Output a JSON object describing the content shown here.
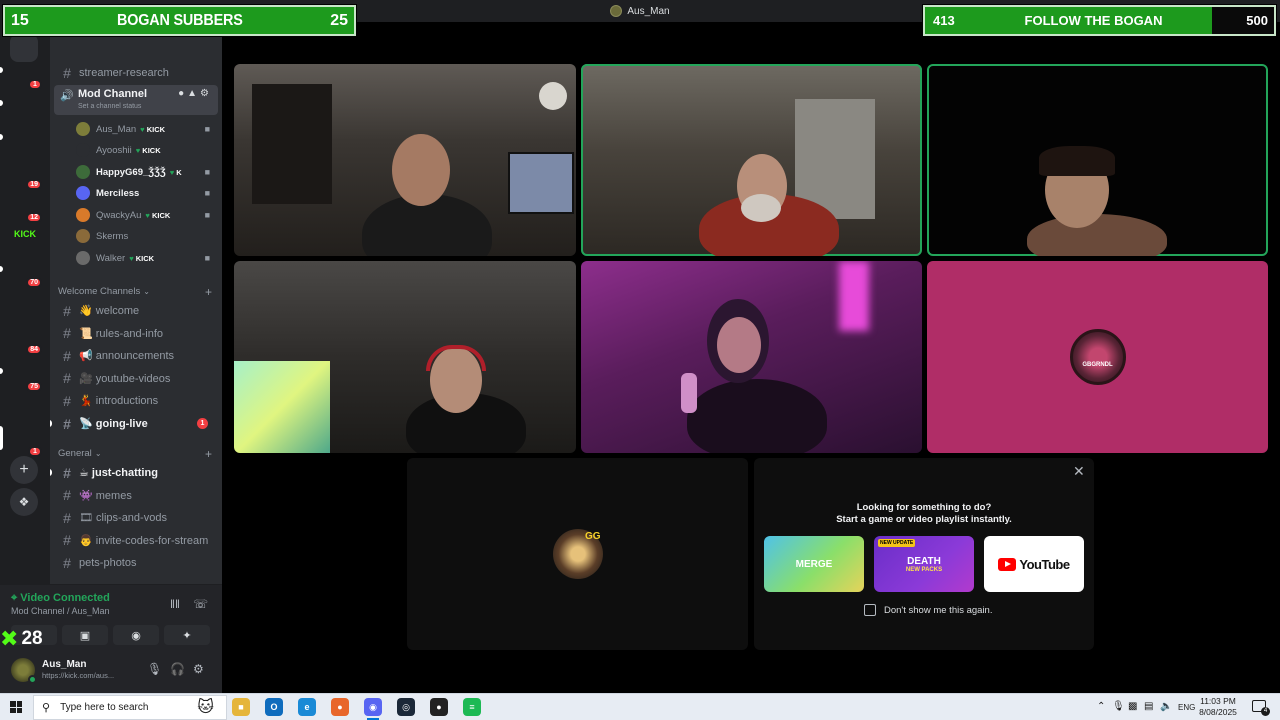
{
  "window": {
    "title": "Aus_Man"
  },
  "overlay_left": {
    "left_value": "15",
    "title": "BOGAN SUBBERS",
    "right_value": "25"
  },
  "overlay_right": {
    "left_value": "413",
    "title": "FOLLOW THE BOGAN",
    "right_value": "500"
  },
  "server_rail": {
    "servers": [
      {
        "badge": "1",
        "color": "#4a6b3c"
      },
      {
        "badge": "",
        "color": "#8b3a2a"
      },
      {
        "badge": "",
        "color": "#d98cae"
      },
      {
        "badge": "19",
        "color": "#e05b9d"
      },
      {
        "badge": "12",
        "color": "#b8862a"
      },
      {
        "badge": "",
        "color": "",
        "text": "KICK"
      },
      {
        "badge": "70",
        "color": "#3d6b3a"
      },
      {
        "badge": "",
        "color": "#c24a6e"
      },
      {
        "badge": "84",
        "color": "#2d2d2d"
      },
      {
        "badge": "75",
        "color": "#7a2b4a"
      },
      {
        "badge": "",
        "color": "#2f3a2a"
      },
      {
        "badge": "1",
        "color": "#5a7a3a"
      }
    ],
    "add_icon": "plus-icon",
    "discover_icon": "compass-icon"
  },
  "sidebar": {
    "server_name": "Aus_Man",
    "channels_top": [
      {
        "name": "streamer-research"
      }
    ],
    "voice_channel": {
      "name": "Mod Channel",
      "status": "Set a channel status",
      "members": [
        {
          "name": "Aus_Man",
          "badge": "KICK",
          "color": "#7d7d3a",
          "cam": true,
          "strong": false
        },
        {
          "name": "Ayooshii",
          "badge": "KICK",
          "color": "",
          "cam": false,
          "strong": false
        },
        {
          "name": "HappyG69_ǮǮǮ",
          "badge": "K",
          "color": "#3d6b3a",
          "cam": true,
          "strong": true
        },
        {
          "name": "Merciless",
          "badge": "",
          "color": "#5865f2",
          "cam": true,
          "strong": true
        },
        {
          "name": "QwackyAu",
          "badge": "KICK",
          "color": "#d97a2a",
          "cam": true,
          "strong": false
        },
        {
          "name": "Skerms",
          "badge": "",
          "color": "#8a6a3a",
          "cam": false,
          "strong": false
        },
        {
          "name": "Walker",
          "badge": "KICK",
          "color": "#6a6a6a",
          "cam": true,
          "strong": false
        }
      ]
    },
    "welcome_category": "Welcome Channels",
    "welcome_channels": [
      {
        "name": "👋 welcome",
        "bold": false,
        "badge": ""
      },
      {
        "name": "📜 rules-and-info",
        "bold": false,
        "badge": ""
      },
      {
        "name": "📢 announcements",
        "bold": false,
        "badge": ""
      },
      {
        "name": "🎥 youtube-videos",
        "bold": false,
        "badge": ""
      },
      {
        "name": "💃 introductions",
        "bold": false,
        "badge": ""
      },
      {
        "name": "📡 going-live",
        "bold": true,
        "badge": "1"
      }
    ],
    "general_category": "General",
    "general_channels": [
      {
        "name": "☕ just-chatting",
        "bold": true
      },
      {
        "name": "👾 memes",
        "bold": false
      },
      {
        "name": "🎞 clips-and-vods",
        "bold": false
      },
      {
        "name": "👨 invite-codes-for-stream",
        "bold": false
      },
      {
        "name": "pets-photos",
        "bold": false
      }
    ]
  },
  "voice_panel": {
    "status": "Video Connected",
    "location": "Mod Channel / Aus_Man",
    "fps": "28"
  },
  "user_panel": {
    "name": "Aus_Man",
    "sub": "https://kick.com/aus..."
  },
  "activity": {
    "title_line1": "Looking for something to do?",
    "title_line2": "Start a game or video playlist instantly.",
    "cards": [
      {
        "label": "MERGE",
        "kind": "merge"
      },
      {
        "label": "DEATH",
        "kind": "death",
        "tag": "NEW UPDATE",
        "sub": "NEW PACKS"
      },
      {
        "label": "YouTube",
        "kind": "yt"
      }
    ],
    "checkbox_label": "Don't show me this again."
  },
  "taskbar": {
    "search_placeholder": "Type here to search",
    "apps": [
      {
        "name": "file-explorer",
        "color": "#e5b53a",
        "glyph": "■"
      },
      {
        "name": "outlook",
        "color": "#0f6cbd",
        "glyph": "O"
      },
      {
        "name": "edge",
        "color": "#1a8ad6",
        "glyph": "e"
      },
      {
        "name": "firefox",
        "color": "#e8662a",
        "glyph": "●"
      },
      {
        "name": "discord",
        "color": "#5865f2",
        "glyph": "◉"
      },
      {
        "name": "steam",
        "color": "#1b2838",
        "glyph": "◎"
      },
      {
        "name": "obs",
        "color": "#222222",
        "glyph": "●"
      },
      {
        "name": "spotify",
        "color": "#1db954",
        "glyph": "≡"
      }
    ],
    "language": "ENG",
    "time": "11:03 PM",
    "date": "8/08/2025"
  }
}
